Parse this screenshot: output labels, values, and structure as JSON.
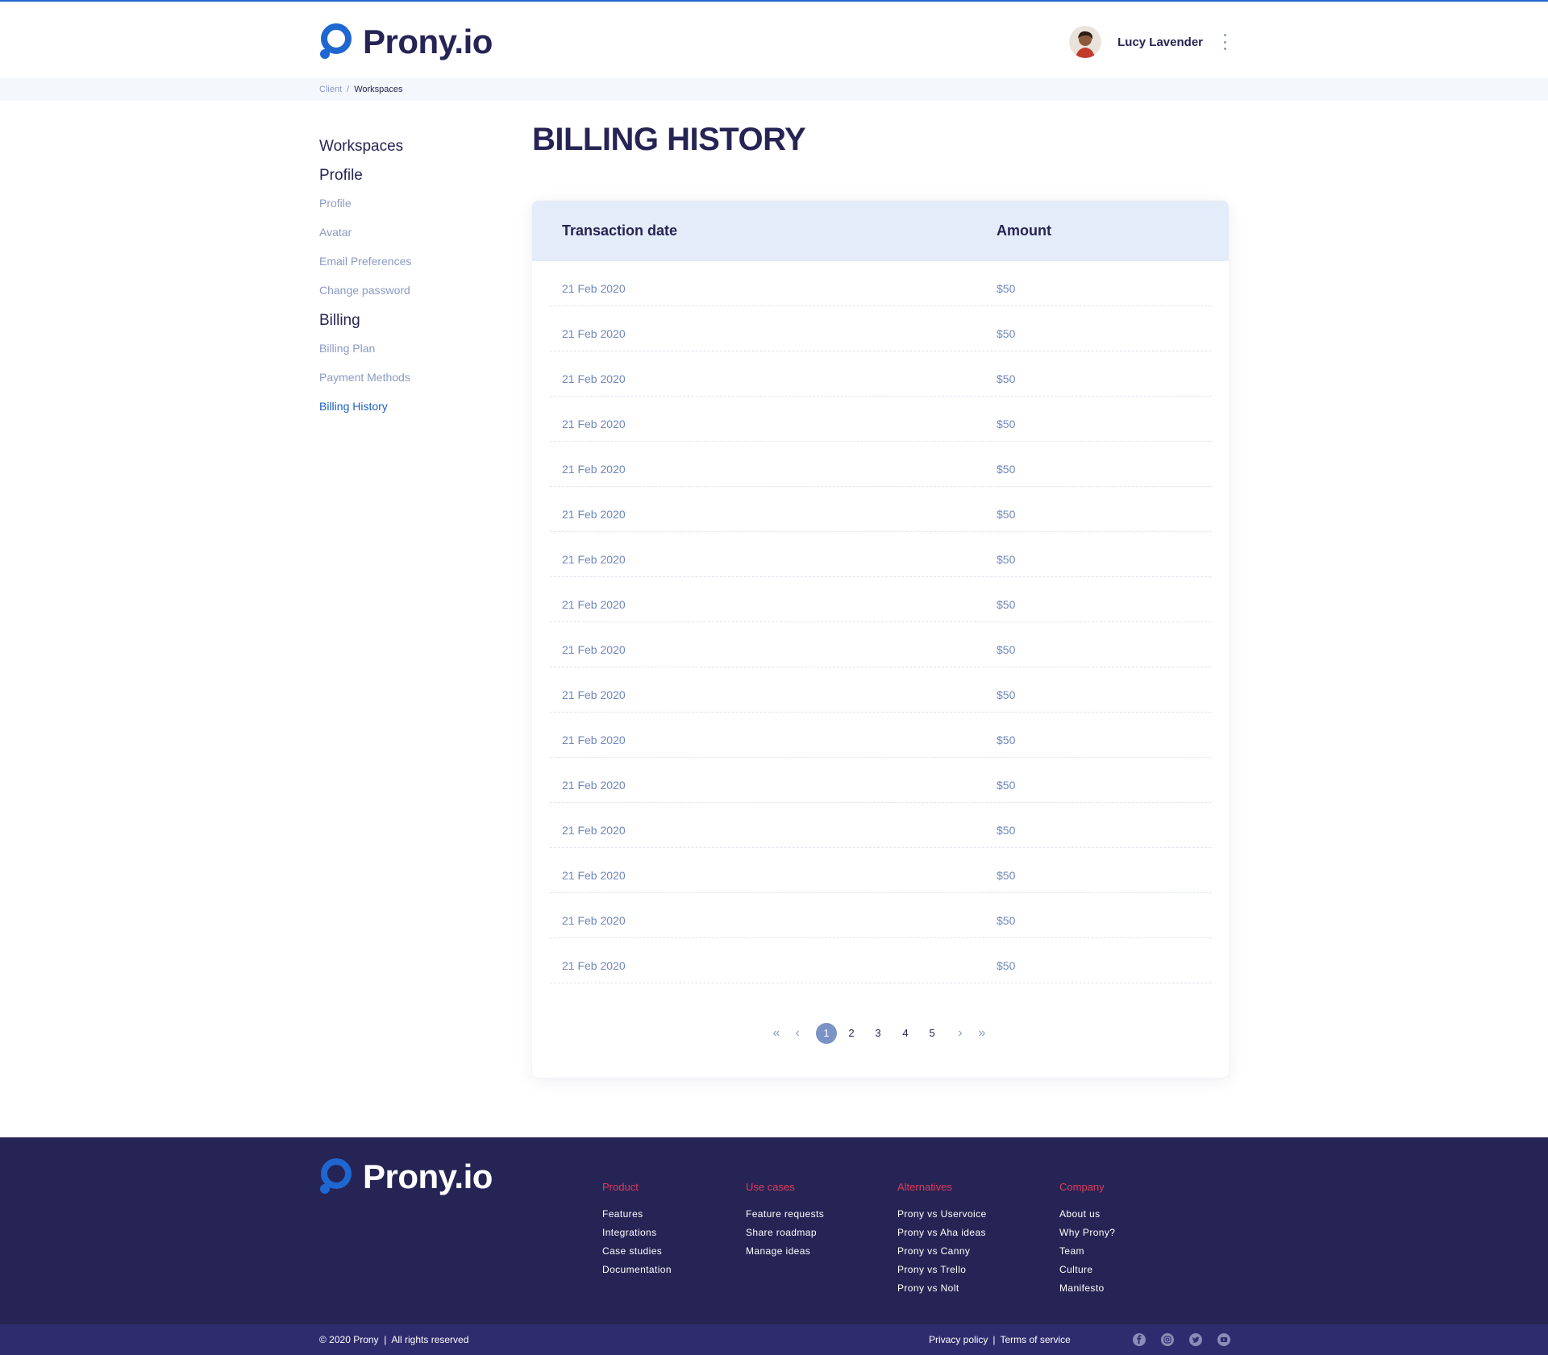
{
  "header": {
    "brand": "Prony.io",
    "user_name": "Lucy Lavender"
  },
  "breadcrumb": {
    "items": [
      "Client",
      "Workspaces"
    ],
    "separator": "/"
  },
  "sidebar": {
    "workspaces": "Workspaces",
    "profile_heading": "Profile",
    "profile_items": [
      "Profile",
      "Avatar",
      "Email Preferences",
      "Change password"
    ],
    "billing_heading": "Billing",
    "billing_items": [
      "Billing Plan",
      "Payment Methods",
      "Billing History"
    ],
    "active_item": "Billing History"
  },
  "main": {
    "title": "BILLING HISTORY",
    "table": {
      "columns": [
        "Transaction date",
        "Amount"
      ],
      "rows": [
        [
          "21 Feb 2020",
          "$50"
        ],
        [
          "21 Feb 2020",
          "$50"
        ],
        [
          "21 Feb 2020",
          "$50"
        ],
        [
          "21 Feb 2020",
          "$50"
        ],
        [
          "21 Feb 2020",
          "$50"
        ],
        [
          "21 Feb 2020",
          "$50"
        ],
        [
          "21 Feb 2020",
          "$50"
        ],
        [
          "21 Feb 2020",
          "$50"
        ],
        [
          "21 Feb 2020",
          "$50"
        ],
        [
          "21 Feb 2020",
          "$50"
        ],
        [
          "21 Feb 2020",
          "$50"
        ],
        [
          "21 Feb 2020",
          "$50"
        ],
        [
          "21 Feb 2020",
          "$50"
        ],
        [
          "21 Feb 2020",
          "$50"
        ],
        [
          "21 Feb 2020",
          "$50"
        ],
        [
          "21 Feb 2020",
          "$50"
        ]
      ]
    },
    "pagination": {
      "first": "«",
      "prev": "‹",
      "pages": [
        "1",
        "2",
        "3",
        "4",
        "5"
      ],
      "current": "1",
      "next": "›",
      "last": "»"
    }
  },
  "footer": {
    "brand": "Prony.io",
    "columns": [
      {
        "title": "Product",
        "items": [
          "Features",
          "Integrations",
          "Case studies",
          "Documentation"
        ]
      },
      {
        "title": "Use cases",
        "items": [
          "Feature requests",
          "Share roadmap",
          "Manage ideas"
        ]
      },
      {
        "title": "Alternatives",
        "items": [
          "Prony vs Uservoice",
          "Prony vs Aha ideas",
          "Prony vs Canny",
          "Prony vs Trello",
          "Prony vs Nolt"
        ]
      },
      {
        "title": "Company",
        "items": [
          "About us",
          "Why Prony?",
          "Team",
          "Culture",
          "Manifesto"
        ]
      }
    ],
    "copyright": "© 2020 Prony  |  All rights reserved",
    "privacy": "Privacy policy",
    "legal_separator": "|",
    "terms": "Terms of service",
    "socials": [
      "facebook-icon",
      "instagram-icon",
      "twitter-icon",
      "youtube-icon"
    ]
  },
  "colors": {
    "accent": "#1e66d0",
    "navy": "#262454",
    "muted": "#8a9ac5",
    "table_head": "#e5ecf9",
    "footer_bg": "#262454",
    "footer_title": "#e23a5b"
  }
}
